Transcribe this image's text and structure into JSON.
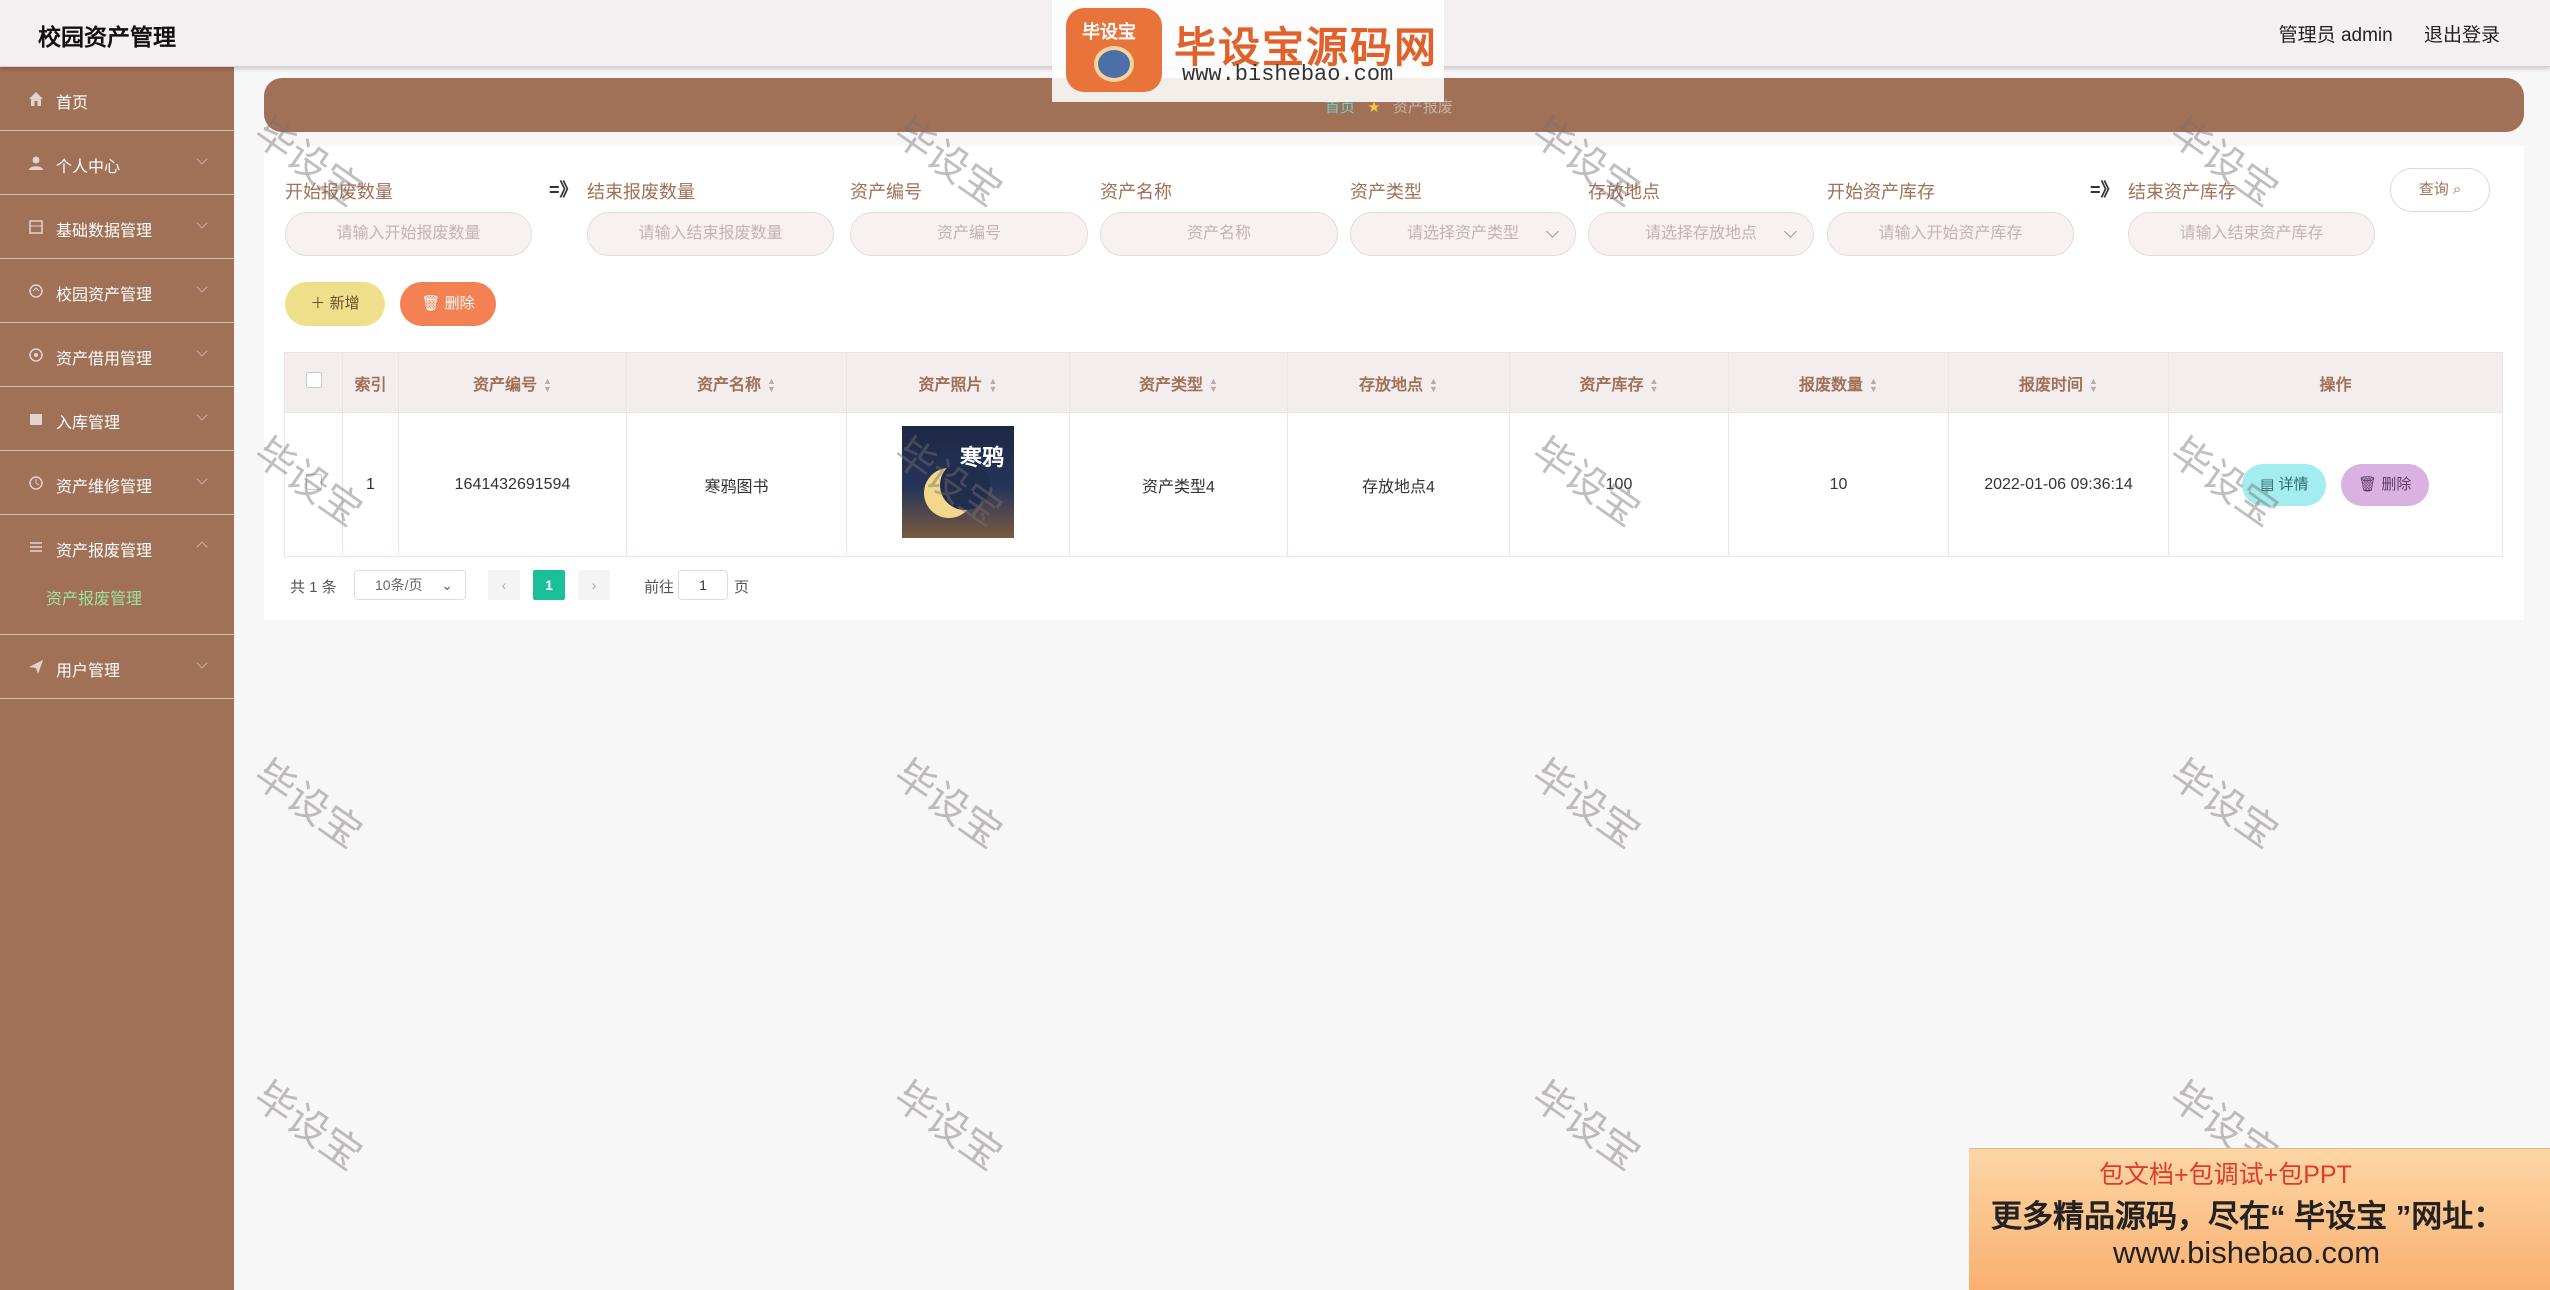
{
  "header": {
    "app_title": "校园资产管理",
    "user_label": "管理员 admin",
    "logout_label": "退出登录"
  },
  "logo": {
    "badge_text": "毕设宝",
    "title": "毕设宝源码网",
    "url": "www.bishebao.com"
  },
  "sidebar": {
    "items": [
      {
        "label": "首页",
        "icon": "home-icon"
      },
      {
        "label": "个人中心",
        "icon": "user-icon"
      },
      {
        "label": "基础数据管理",
        "icon": "database-icon"
      },
      {
        "label": "校园资产管理",
        "icon": "asset-icon"
      },
      {
        "label": "资产借用管理",
        "icon": "borrow-icon"
      },
      {
        "label": "入库管理",
        "icon": "warehouse-icon"
      },
      {
        "label": "资产维修管理",
        "icon": "repair-icon"
      },
      {
        "label": "资产报废管理",
        "icon": "list-icon"
      },
      {
        "label": "用户管理",
        "icon": "send-icon"
      }
    ],
    "sub_active": "资产报废管理"
  },
  "breadcrumb": {
    "home": "首页",
    "current": "资产报废"
  },
  "search": {
    "labels": {
      "start_scrap": "开始报废数量",
      "end_scrap": "结束报废数量",
      "asset_code": "资产编号",
      "asset_name": "资产名称",
      "asset_type": "资产类型",
      "location": "存放地点",
      "start_stock": "开始资产库存",
      "end_stock": "结束资产库存"
    },
    "placeholders": {
      "start_scrap": "请输入开始报废数量",
      "end_scrap": "请输入结束报废数量",
      "asset_code": "资产编号",
      "asset_name": "资产名称",
      "asset_type": "请选择资产类型",
      "location": "请选择存放地点",
      "start_stock": "请输入开始资产库存",
      "end_stock": "请输入结束资产库存"
    },
    "range_arrow": "=》",
    "query_label": "查询"
  },
  "actions": {
    "add_label": "新增",
    "delete_label": "删除"
  },
  "table": {
    "columns": {
      "index": "索引",
      "asset_code": "资产编号",
      "asset_name": "资产名称",
      "asset_photo": "资产照片",
      "asset_type": "资产类型",
      "location": "存放地点",
      "stock": "资产库存",
      "scrap_qty": "报废数量",
      "scrap_time": "报废时间",
      "operation": "操作"
    },
    "rows": [
      {
        "index": "1",
        "asset_code": "1641432691594",
        "asset_name": "寒鸦图书",
        "photo_title": "寒鸦",
        "asset_type": "资产类型4",
        "location": "存放地点4",
        "stock": "100",
        "scrap_qty": "10",
        "scrap_time": "2022-01-06 09:36:14",
        "detail_label": "详情",
        "delete_label": "删除"
      }
    ]
  },
  "pagination": {
    "total": "共 1 条",
    "page_size": "10条/页",
    "prev": "‹",
    "current_page": "1",
    "next": "›",
    "goto_prefix": "前往",
    "goto_value": "1",
    "goto_suffix": "页"
  },
  "watermark": {
    "text": "毕设宝"
  },
  "ad": {
    "line1": "包文档+包调试+包PPT",
    "line2": "更多精品源码，尽在“ 毕设宝 ”网址：",
    "line3": "www.bishebao.com"
  }
}
